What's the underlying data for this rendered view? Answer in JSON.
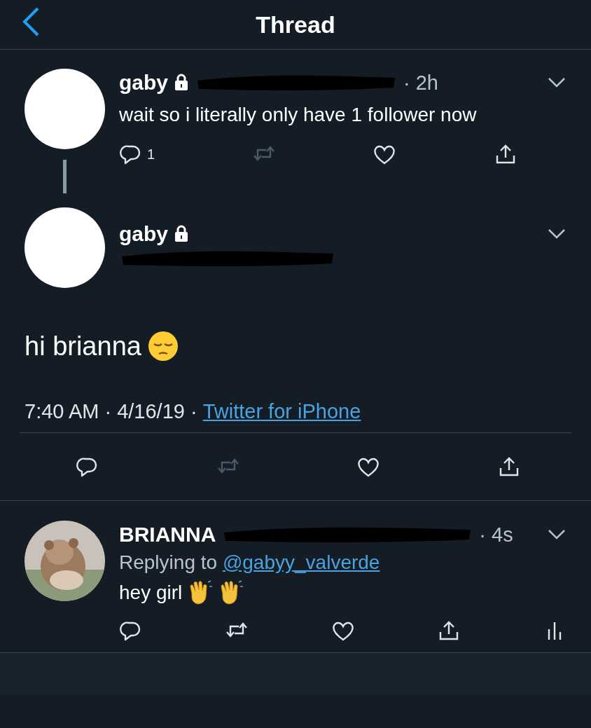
{
  "header": {
    "title": "Thread"
  },
  "tweets": [
    {
      "kind": "parent",
      "name": "gaby",
      "locked": true,
      "handle_redacted": true,
      "time": "· 2h",
      "text": "wait so i literally only have 1 follower now",
      "actions": [
        {
          "kind": "reply",
          "count": "1",
          "disabled": false
        },
        {
          "kind": "retweet",
          "disabled": true
        },
        {
          "kind": "like",
          "disabled": false
        },
        {
          "kind": "share",
          "disabled": false
        }
      ]
    },
    {
      "kind": "focus",
      "name": "gaby",
      "locked": true,
      "handle_redacted": true,
      "text": "hi brianna",
      "stickers": [
        {
          "kind": "sad-face"
        }
      ],
      "meta": "7:40 AM · 4/16/19 ·",
      "source": "Twitter for iPhone",
      "actions": [
        {
          "kind": "reply",
          "disabled": false
        },
        {
          "kind": "retweet",
          "disabled": true
        },
        {
          "kind": "like",
          "disabled": false
        },
        {
          "kind": "share",
          "disabled": false
        }
      ]
    },
    {
      "kind": "reply",
      "avatar": {
        "kind": "picture"
      },
      "name": "BRIANNA",
      "locked": false,
      "handle_redacted": true,
      "time": "· 4s",
      "replying_prefix": "Replying to",
      "replying_to": "@gabyy_valverde",
      "text": "hey girl",
      "stickers": [
        {
          "kind": "wave"
        },
        {
          "kind": "wave"
        }
      ],
      "actions": [
        {
          "kind": "reply",
          "disabled": false
        },
        {
          "kind": "retweet",
          "disabled": false
        },
        {
          "kind": "like",
          "disabled": false
        },
        {
          "kind": "share",
          "disabled": false
        },
        {
          "kind": "analytics",
          "disabled": false
        }
      ]
    }
  ]
}
